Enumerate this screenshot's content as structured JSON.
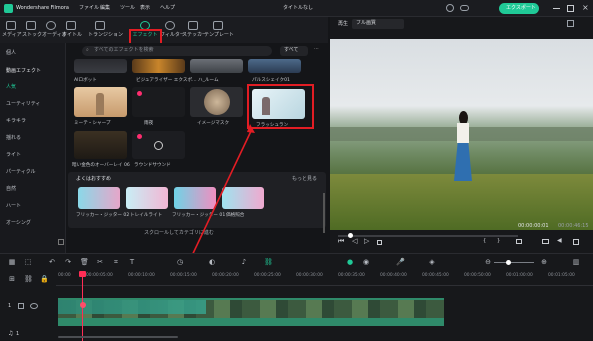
{
  "app": {
    "title": "Wondershare Filmora",
    "menu": [
      "ファイル",
      "編集",
      "ツール",
      "表示",
      "ヘルプ"
    ],
    "doc_title": "タイトルなし",
    "export_label": "エクスポート"
  },
  "media_tabs": [
    "メディア",
    "ストック",
    "オーディオ",
    "タイトル",
    "トランジション",
    "エフェクト",
    "フィルター",
    "ステッカー",
    "テンプレート"
  ],
  "sidebar": {
    "top": "個人",
    "section": "動画エフェクト",
    "items": [
      "人気",
      "ユーティリティ",
      "キラキラ",
      "揺れる",
      "ライト",
      "パーティクル",
      "自然",
      "ハート",
      "オーシング"
    ]
  },
  "search": {
    "placeholder": "すべてのエフェクトを検索",
    "filter": "すべて"
  },
  "effects_row0": [
    "AIロボット",
    "ビジュアライザー エクスポ…",
    "ハ_ルーム",
    "パルスシェイク01"
  ],
  "effects_row1": [
    "ミーテ・シャープ",
    "雨夜",
    "イメージマスク",
    "フラッシュラン"
  ],
  "effects_row2": [
    "暗い金色のオーバーレイ 06",
    "ラウンドサウンド"
  ],
  "recommended": {
    "title": "よくはおすすめ",
    "more": "もっと見る",
    "items": [
      "フリッカー・ジッター 02",
      "トレイルライト",
      "フリッカー・ジッター 01",
      "価格照合"
    ]
  },
  "scroll_hint": "スクロールしてカテゴリに進む",
  "preview": {
    "player_label": "再生",
    "quality": "フル画質",
    "current_time": "00:00:00:01",
    "total_time": "00:00:46:15"
  },
  "timeline": {
    "ruler": [
      "00:00",
      "00:00:05:00",
      "00:00:10:00",
      "00:00:15:00",
      "00:00:20:00",
      "00:00:25:00",
      "00:00:30:00",
      "00:00:35:00",
      "00:00:40:00",
      "00:00:45:00",
      "00:00:50:00",
      "00:01:00:00",
      "00:01:05:00"
    ],
    "track_video": "1",
    "track_audio": "1"
  },
  "colors": {
    "accent": "#20c997",
    "highlight": "#e21d24",
    "pink": "#ff2d6f"
  }
}
